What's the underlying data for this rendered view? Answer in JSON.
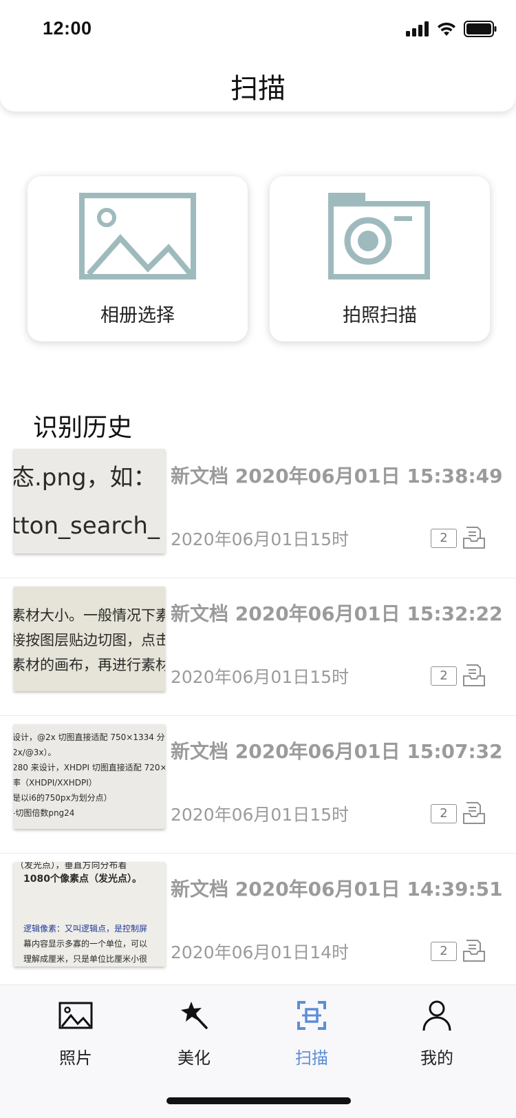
{
  "status_bar": {
    "time": "12:00"
  },
  "header": {
    "title": "扫描"
  },
  "actions": {
    "album": {
      "label": "相册选择",
      "icon": "image-icon"
    },
    "camera": {
      "label": "拍照扫描",
      "icon": "camera-icon"
    }
  },
  "history": {
    "title": "识别历史",
    "items": [
      {
        "title": "新文档 2020年06月01日 15:38:49",
        "subtitle": "2020年06月01日15时",
        "count": "2",
        "thumb_lines": [
          "态.png，如：",
          "tton_search_"
        ]
      },
      {
        "title": "新文档 2020年06月01日 15:32:22",
        "subtitle": "2020年06月01日15时",
        "count": "2",
        "thumb_lines": [
          "素材大小。一般情况下素",
          "接按图层贴边切图，点击",
          "素材的画布，再进行素材"
        ]
      },
      {
        "title": "新文档 2020年06月01日 15:07:32",
        "subtitle": "2020年06月01日15时",
        "count": "2",
        "thumb_lines": [
          "设计，@2x 切图直接适配 750×1334 分",
          "2x/@3x）。",
          "280 来设计，XHDPI 切图直接适配 720×",
          "率（XHDPI/XXHDPI）",
          "是以i6的750px为划分点）",
          "-切图倍数png24"
        ]
      },
      {
        "title": "新文档 2020年06月01日 14:39:51",
        "subtitle": "2020年06月01日14时",
        "count": "2",
        "thumb_lines": [
          "（发光点），垂直方向分布着",
          "1080个像素点（发光点）。",
          "逻辑像素：又叫逻辑点，是控制屏",
          "幕内容显示多寡的一个单位，可以",
          "理解成厘米，只是单位比厘米小很"
        ]
      }
    ]
  },
  "tabbar": {
    "tabs": [
      {
        "label": "照片",
        "icon": "photo-icon"
      },
      {
        "label": "美化",
        "icon": "magic-wand-icon"
      },
      {
        "label": "扫描",
        "icon": "scan-icon",
        "active": true
      },
      {
        "label": "我的",
        "icon": "user-icon"
      }
    ],
    "active_color": "#5b8ed6"
  },
  "colors": {
    "icon_teal": "#9fbabc",
    "muted_text": "#9b9b9b"
  }
}
